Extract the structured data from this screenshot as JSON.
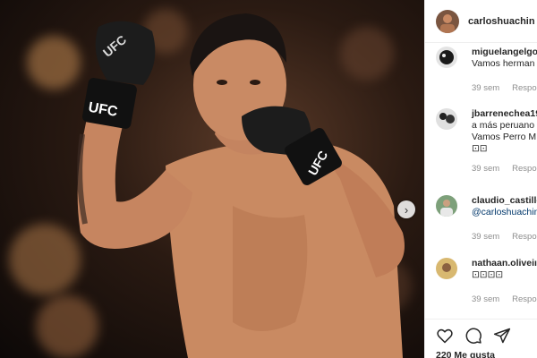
{
  "post": {
    "owner": "carloshuachin",
    "image_alt": "Fighter in UFC gloves in fighting stance",
    "glove_brand": "UFC"
  },
  "comments": [
    {
      "user": "miguelangelgo",
      "text": "Vamos herman",
      "mention": "",
      "time": "39 sem",
      "reply": "Respon"
    },
    {
      "user": "jbarrenechea19",
      "text": "a más peruano",
      "text2": "Vamos Perro M",
      "text3": "⊡⊡",
      "mention": "",
      "time": "39 sem",
      "reply": "Respon"
    },
    {
      "user": "claudio_castillo",
      "text": "",
      "mention": "@carloshuachin",
      "time": "39 sem",
      "reply": "Respon"
    },
    {
      "user": "nathaan.oliveiı",
      "text": "⊡⊡⊡⊡",
      "mention": "",
      "time": "39 sem",
      "reply": "Respon"
    }
  ],
  "footer": {
    "likes": "220 Me gusta"
  },
  "icons": {
    "like": "heart-icon",
    "comment": "comment-icon",
    "share": "share-icon",
    "next": "chevron-right-icon"
  }
}
